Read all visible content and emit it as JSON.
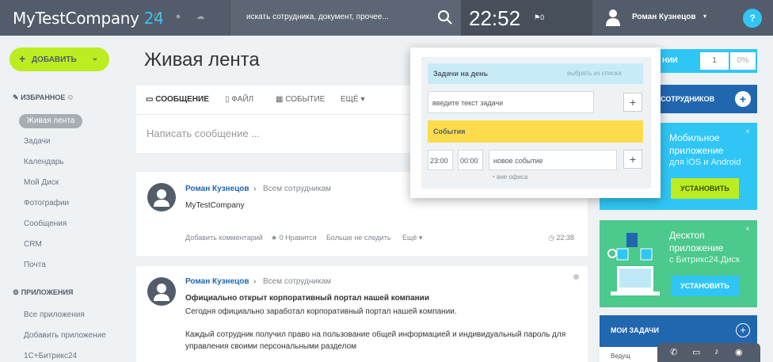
{
  "header": {
    "logo_main": "MyTestCompany",
    "logo_num": "24",
    "search_placeholder": "искать сотрудника, документ, прочее...",
    "clock": "22:52",
    "clock_flag": "⚑0",
    "user_name": "Роман Кузнецов",
    "help": "?"
  },
  "sidebar": {
    "add_label": "ДОБАВИТЬ",
    "favorites_title": "ИЗБРАННОЕ",
    "items": [
      "Живая лента",
      "Задачи",
      "Календарь",
      "Мой Диск",
      "Фотографии",
      "Сообщения",
      "CRM",
      "Почта"
    ],
    "apps_title": "ПРИЛОЖЕНИЯ",
    "app_items": [
      "Все приложения",
      "Добавить приложение",
      "1С+Битрикс24"
    ]
  },
  "page": {
    "title": "Живая лента"
  },
  "composer": {
    "tabs": [
      "СООБЩЕНИЕ",
      "ФАЙЛ",
      "СОБЫТИЕ",
      "ЕЩЁ"
    ],
    "placeholder": "Написать сообщение ..."
  },
  "posts": [
    {
      "author": "Роман Кузнецов",
      "arrow": "›",
      "dest": "Всем сотрудникам",
      "text": "MyTestCompany",
      "links": [
        "Добавить комментарий",
        "0 Нравится",
        "Больше не следить",
        "Ещё"
      ],
      "time": "22:38"
    },
    {
      "author": "Роман Кузнецов",
      "arrow": "›",
      "dest": "Всем сотрудникам",
      "title": "Официально открыт корпоративный портал нашей компании",
      "line1": "Сегодня официально заработал корпоративный портал нашей компании.",
      "line2": "Каждый сотрудник получил право на пользование общей информацией и индивидуальный пароль для",
      "line3": "управления своими персональными разделом"
    }
  ],
  "popup": {
    "tasks_title": "Задачи на день",
    "tasks_link": "выбрать из списка",
    "task_placeholder": "введите текст задачи",
    "events_title": "События",
    "time_from": "23:00",
    "time_to": "00:00",
    "event_placeholder": "новое событие",
    "offline": "вне офиса"
  },
  "right": {
    "top_label": "НИИ",
    "top_count": "1",
    "top_percent": "0%",
    "invite_label": "СОТРУДНИКОВ",
    "mobile_title_1": "Мобильное",
    "mobile_title_2": "приложение",
    "mobile_sub": "для iOS и Android",
    "install": "УСТАНОВИТЬ",
    "desktop_title_1": "Десктоп",
    "desktop_title_2": "приложение",
    "desktop_sub": "с Битрикс24.Диск",
    "my_tasks": "МОИ ЗАДАЧИ",
    "my_tasks_item": "Ведущ"
  }
}
